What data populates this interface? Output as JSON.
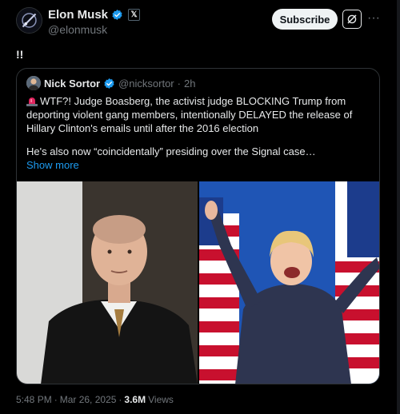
{
  "author": {
    "display_name": "Elon Musk",
    "handle": "@elonmusk",
    "affiliation_badge": "𝕏",
    "verified": true
  },
  "header": {
    "subscribe_label": "Subscribe",
    "grok_icon": "grok-icon",
    "more_icon": "more-icon",
    "more_glyph": "···"
  },
  "post": {
    "text": "!!"
  },
  "quote": {
    "display_name": "Nick Sortor",
    "handle": "@nicksortor",
    "separator": "·",
    "time": "2h",
    "body": "WTF?! Judge Boasberg, the activist judge BLOCKING Trump from deporting violent gang members, intentionally DELAYED the release of Hillary Clinton's emails until after the 2016 election",
    "body2": "He's also now “coincidentally” presiding over the Signal case…",
    "show_more": "Show more",
    "media": [
      {
        "alt": "judge-photo"
      },
      {
        "alt": "hillary-clinton-photo"
      }
    ]
  },
  "footer": {
    "time": "5:48 PM",
    "dot1": "·",
    "date": "Mar 26, 2025",
    "dot2": "·",
    "views_count": "3.6M",
    "views_label": "Views"
  },
  "colors": {
    "background": "#000000",
    "text": "#e7e9ea",
    "muted": "#71767b",
    "link": "#1d9bf0",
    "border": "#2f3336",
    "verified": "#1d9bf0"
  }
}
